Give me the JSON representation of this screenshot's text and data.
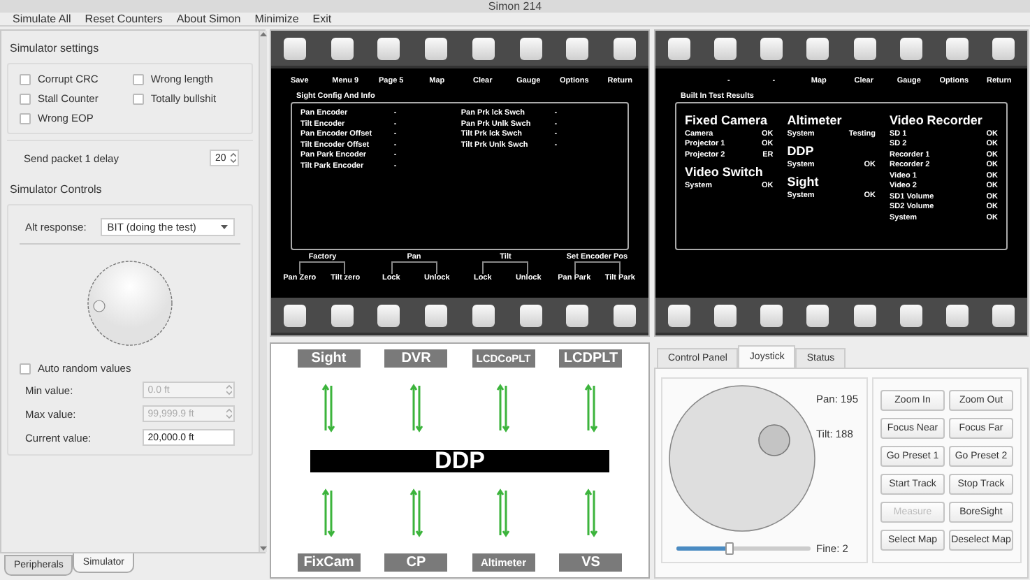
{
  "window": {
    "title": "Simon 214"
  },
  "menu": [
    "Simulate All",
    "Reset Counters",
    "About Simon",
    "Minimize",
    "Exit"
  ],
  "simulator_settings": {
    "title": "Simulator settings",
    "checkboxes": [
      {
        "label": "Corrupt CRC",
        "checked": false
      },
      {
        "label": "Wrong length",
        "checked": false
      },
      {
        "label": "Stall Counter",
        "checked": false
      },
      {
        "label": "Totally bullshit",
        "checked": false
      },
      {
        "label": "Wrong EOP",
        "checked": false
      }
    ],
    "delay": {
      "label": "Send packet 1 delay",
      "value": "20"
    }
  },
  "simulator_controls": {
    "title": "Simulator Controls",
    "alt_response": {
      "label": "Alt response:",
      "value": "BIT (doing the test)"
    },
    "auto_random": {
      "label": "Auto random values",
      "checked": false
    },
    "fields": [
      {
        "label": "Min value:",
        "value": "0.0 ft",
        "kind": "spin",
        "disabled": true
      },
      {
        "label": "Max value:",
        "value": "99,999.9 ft",
        "kind": "spin",
        "disabled": true
      },
      {
        "label": "Current value:",
        "value": "20,000.0 ft",
        "kind": "text",
        "disabled": false
      }
    ]
  },
  "left_tabs": [
    {
      "label": "Peripherals",
      "selected": false
    },
    {
      "label": "Simulator",
      "selected": true
    }
  ],
  "displays": [
    {
      "kind": "config",
      "top_labels": [
        "Save",
        "Menu 9",
        "Page 5",
        "Map",
        "Clear",
        "Gauge",
        "Options",
        "Return"
      ],
      "title": "Sight Config And Info",
      "columns": [
        [
          {
            "label": "Pan Encoder",
            "value": "-"
          },
          {
            "label": "Tilt Encoder",
            "value": "-"
          },
          {
            "label": "Pan Encoder Offset",
            "value": "-"
          },
          {
            "label": "Tilt Encoder Offset",
            "value": "-"
          },
          {
            "label": "Pan Park Encoder",
            "value": "-"
          },
          {
            "label": "Tilt Park Encoder",
            "value": "-"
          }
        ],
        [
          {
            "label": "Pan Prk lck Swch",
            "value": "-"
          },
          {
            "label": "Pan Prk Unlk Swch",
            "value": "-"
          },
          {
            "label": "Tilt Prk lck Swch",
            "value": "-"
          },
          {
            "label": "Tilt Prk Unlk Swch",
            "value": "-"
          }
        ]
      ],
      "groups": [
        {
          "title": "Factory",
          "buttons": [
            "Pan Zero",
            "Tilt zero"
          ]
        },
        {
          "title": "Pan",
          "buttons": [
            "Lock",
            "Unlock"
          ]
        },
        {
          "title": "Tilt",
          "buttons": [
            "Lock",
            "Unlock"
          ]
        },
        {
          "title": "Set Encoder Pos",
          "buttons": [
            "Pan Park",
            "Tilt Park"
          ]
        }
      ]
    },
    {
      "kind": "bit",
      "top_labels": [
        "-",
        "-",
        "Map",
        "Clear",
        "Gauge",
        "Options",
        "Return"
      ],
      "title": "Built In Test Results",
      "columns": [
        [
          {
            "title": "Fixed Camera",
            "rows": [
              {
                "label": "Camera",
                "value": "OK"
              },
              {
                "label": "Projector 1",
                "value": "OK"
              },
              {
                "label": "Projector 2",
                "value": "ER"
              }
            ]
          },
          {
            "title": "Video Switch",
            "rows": [
              {
                "label": "System",
                "value": "OK"
              }
            ]
          }
        ],
        [
          {
            "title": "Altimeter",
            "rows": [
              {
                "label": "System",
                "value": "Testing"
              }
            ]
          },
          {
            "title": "DDP",
            "rows": [
              {
                "label": "System",
                "value": "OK"
              }
            ]
          },
          {
            "title": "Sight",
            "rows": [
              {
                "label": "System",
                "value": "OK"
              }
            ]
          }
        ],
        [
          {
            "title": "Video Recorder",
            "rows": [
              {
                "label": "SD 1",
                "value": "OK"
              },
              {
                "label": "SD 2",
                "value": "OK"
              },
              {
                "label": "Recorder 1",
                "value": "OK"
              },
              {
                "label": "Recorder 2",
                "value": "OK"
              },
              {
                "label": "Video 1",
                "value": "OK"
              },
              {
                "label": "Video 2",
                "value": "OK"
              },
              {
                "label": "SD1 Volume",
                "value": "OK"
              },
              {
                "label": "SD2 Volume",
                "value": "OK"
              },
              {
                "label": "System",
                "value": "OK"
              }
            ]
          }
        ]
      ]
    }
  ],
  "bus": {
    "top_nodes": [
      "Sight",
      "DVR",
      "LCDCoPLT",
      "LCDPLT"
    ],
    "label": "DDP",
    "bottom_nodes": [
      "FixCam",
      "CP",
      "Altimeter",
      "VS"
    ]
  },
  "right_tabs": [
    {
      "label": "Control Panel",
      "selected": false
    },
    {
      "label": "Joystick",
      "selected": true
    },
    {
      "label": "Status",
      "selected": false
    }
  ],
  "joystick": {
    "pan": "Pan: 195",
    "tilt": "Tilt: 188",
    "fine_slider": {
      "reading": "Fine: 2",
      "level": 0.4
    },
    "buttons": [
      {
        "label": "Zoom In",
        "disabled": false
      },
      {
        "label": "Zoom Out",
        "disabled": false
      },
      {
        "label": "Focus Near",
        "disabled": false
      },
      {
        "label": "Focus Far",
        "disabled": false
      },
      {
        "label": "Go Preset 1",
        "disabled": false
      },
      {
        "label": "Go Preset 2",
        "disabled": false
      },
      {
        "label": "Start Track",
        "disabled": false
      },
      {
        "label": "Stop Track",
        "disabled": false
      },
      {
        "label": "Measure",
        "disabled": true
      },
      {
        "label": "BoreSight",
        "disabled": false
      },
      {
        "label": "Select Map",
        "disabled": false
      },
      {
        "label": "Deselect Map",
        "disabled": false
      }
    ]
  }
}
